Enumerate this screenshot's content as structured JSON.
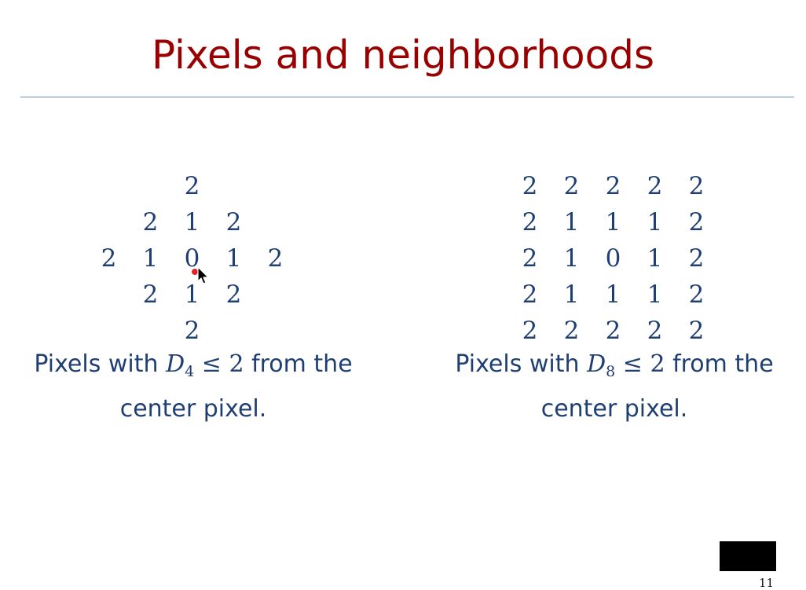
{
  "title": "Pixels and neighborhoods",
  "left": {
    "rows": [
      [
        "",
        "",
        "2",
        "",
        ""
      ],
      [
        "",
        "2",
        "1",
        "2",
        ""
      ],
      [
        "2",
        "1",
        "0",
        "1",
        "2"
      ],
      [
        "",
        "2",
        "1",
        "2",
        ""
      ],
      [
        "",
        "",
        "2",
        "",
        ""
      ]
    ],
    "caption_pre": "Pixels with ",
    "caption_var": "D",
    "caption_sub": "4",
    "caption_rel": " ≤ 2",
    "caption_post": " from the",
    "caption_line2": "center pixel."
  },
  "right": {
    "rows": [
      [
        "2",
        "2",
        "2",
        "2",
        "2"
      ],
      [
        "2",
        "1",
        "1",
        "1",
        "2"
      ],
      [
        "2",
        "1",
        "0",
        "1",
        "2"
      ],
      [
        "2",
        "1",
        "1",
        "1",
        "2"
      ],
      [
        "2",
        "2",
        "2",
        "2",
        "2"
      ]
    ],
    "caption_pre": "Pixels with ",
    "caption_var": "D",
    "caption_sub": "8",
    "caption_rel": " ≤ 2",
    "caption_post": " from the",
    "caption_line2": "center pixel."
  },
  "page_number": "11",
  "colors": {
    "title": "#990000",
    "text": "#1f3f73",
    "rule": "#6a8fc4"
  },
  "icons": {
    "cursor": "mouse-pointer-icon",
    "laser": "laser-pointer-dot-icon"
  }
}
